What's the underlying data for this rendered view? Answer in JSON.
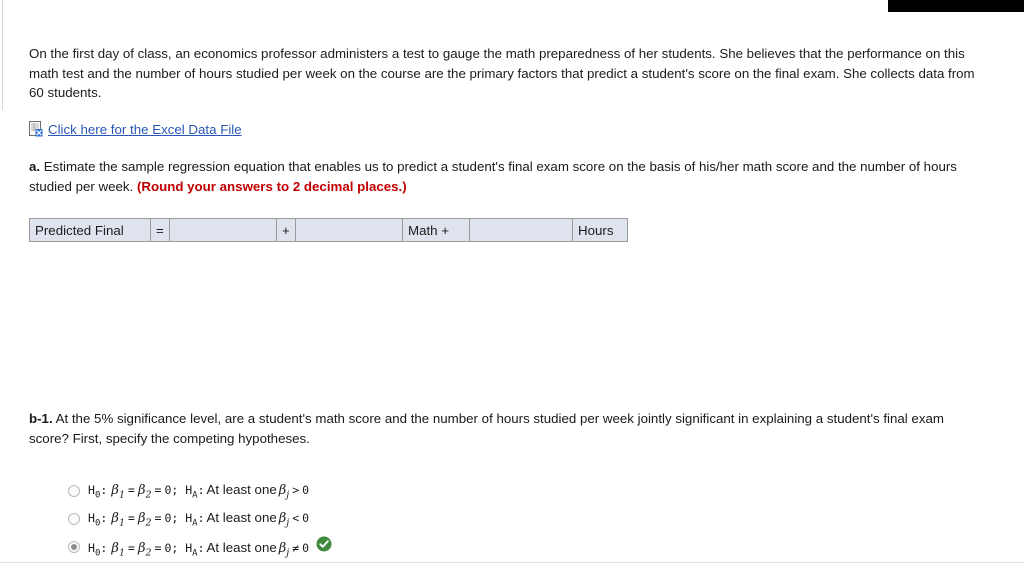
{
  "window": {
    "top_bar_color": "#000000"
  },
  "intro": {
    "text": "On the first day of class, an economics professor administers a test to gauge the math preparedness of her students. She believes that the performance on this math test and the number of hours studied per week on the course are the primary factors that predict a student's score on the final exam. She collects data from 60 students."
  },
  "excel_link": {
    "icon": "excel-spreadsheet-icon",
    "label": "Click here for the Excel Data File",
    "color": "#2a57b5"
  },
  "question_a": {
    "label": "a.",
    "text": "Estimate the sample regression equation that enables us to predict a student's final exam score on the basis of his/her math score and the number of hours studied per week.",
    "note": "(Round your answers to 2 decimal places.)",
    "note_color": "#c00000"
  },
  "answer_table": {
    "fill_color": "#dfe3ed",
    "border_color": "#9a9a9a",
    "cells": [
      {
        "name": "predicted-final-label",
        "text": "Predicted Final",
        "input": false
      },
      {
        "name": "equals-sign",
        "text": "=",
        "input": false
      },
      {
        "name": "intercept-input",
        "text": "",
        "input": true
      },
      {
        "name": "plus-sign",
        "text": "+",
        "input": false
      },
      {
        "name": "math-coefficient-input",
        "text": "",
        "input": true
      },
      {
        "name": "math-plus-label",
        "text": "Math +",
        "input": false
      },
      {
        "name": "hours-coefficient-input",
        "text": "",
        "input": true
      },
      {
        "name": "hours-label",
        "text": "Hours",
        "input": false
      }
    ]
  },
  "question_b1": {
    "label": "b-1.",
    "text": "At the 5% significance level, are a student's math score and the number of hours studied per week jointly significant in explaining a student's final exam score? First, specify the competing hypotheses."
  },
  "options": [
    {
      "id": "option-1",
      "h0_symbol": "H",
      "h0_sub": "0",
      "null_text": "β₁ = β₂ = 0;",
      "ha_symbol": "H",
      "ha_sub": "A",
      "alt_text": "At least one βⱼ > 0",
      "operator": ">",
      "selected": false,
      "correct_mark": false
    },
    {
      "id": "option-2",
      "h0_symbol": "H",
      "h0_sub": "0",
      "null_text": "β₁ = β₂ = 0;",
      "ha_symbol": "H",
      "ha_sub": "A",
      "alt_text": "At least one βⱼ < 0",
      "operator": "<",
      "selected": false,
      "correct_mark": false
    },
    {
      "id": "option-3",
      "h0_symbol": "H",
      "h0_sub": "0",
      "null_text": "β₁ = β₂ = 0;",
      "ha_symbol": "H",
      "ha_sub": "A",
      "alt_text": "At least one βⱼ ≠ 0",
      "operator": "≠",
      "selected": true,
      "correct_mark": true
    }
  ],
  "option_static": {
    "at_least_one": "At least one",
    "zero": "0",
    "eq": "=",
    "semicolon": ";",
    "colon": ":",
    "beta": "β",
    "sub1": "1",
    "sub2": "2",
    "subj": "j"
  },
  "colors": {
    "check_green": "#3f8a3f",
    "link_blue": "#2a57b5",
    "note_red": "#c00000",
    "table_fill": "#dfe3ed"
  }
}
